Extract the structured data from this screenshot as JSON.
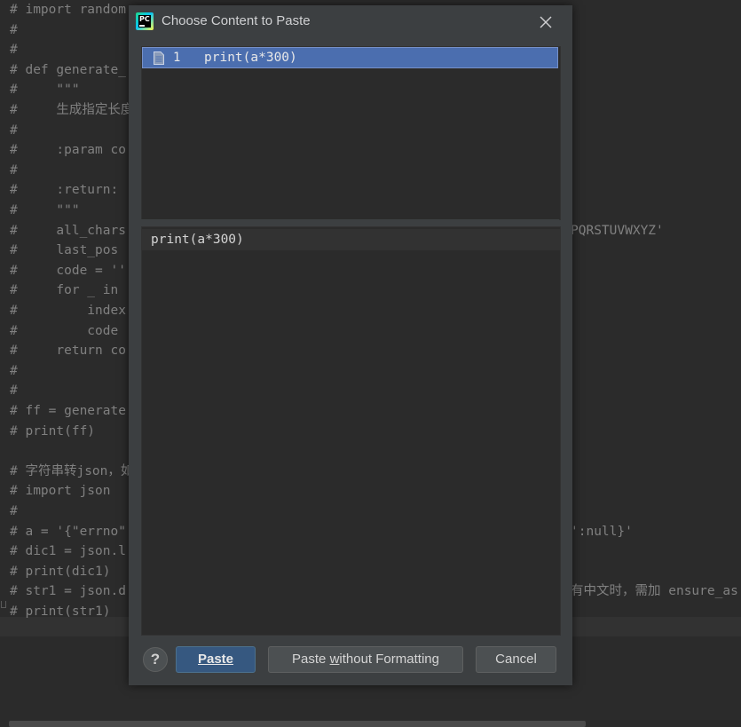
{
  "editor": {
    "lines": [
      "# import random",
      "#",
      "#",
      "# def generate_",
      "#     \"\"\"",
      "#     生成指定长度",
      "#",
      "#     :param co",
      "#",
      "#     :return:",
      "#     \"\"\"",
      "#     all_chars",
      "#     last_pos",
      "#     code = ''",
      "#     for _ in",
      "#         index",
      "#         code",
      "#     return co",
      "#",
      "#",
      "# ff = generate",
      "# print(ff)",
      "",
      "# 字符串转json，如",
      "# import json",
      "#",
      "# a = '{\"errno\"",
      "# dic1 = json.l",
      "# print(dic1)",
      "# str1 = json.d",
      "# print(str1)"
    ],
    "right_fragments": [
      {
        "line": 11,
        "text": "PQRSTUVWXYZ'"
      },
      {
        "line": 26,
        "text": "':null}'"
      },
      {
        "line": 29,
        "text": "有中文时，需加 ensure_as"
      }
    ]
  },
  "dialog": {
    "title": "Choose Content to Paste",
    "close_icon": "close-icon",
    "items": [
      {
        "number": "1",
        "text": "print(a*300)",
        "icon": "document-icon",
        "selected": true
      }
    ],
    "preview": "print(a*300)",
    "buttons": {
      "help": "?",
      "paste_label": "Paste",
      "paste_without_formatting_label": "Paste without Formatting",
      "cancel_label": "Cancel"
    }
  },
  "colors": {
    "editor_bg": "#2b2b2b",
    "dialog_bg": "#3c3f41",
    "selection": "#4b6eaf",
    "default_button": "#365880",
    "comment_text": "#808080"
  }
}
